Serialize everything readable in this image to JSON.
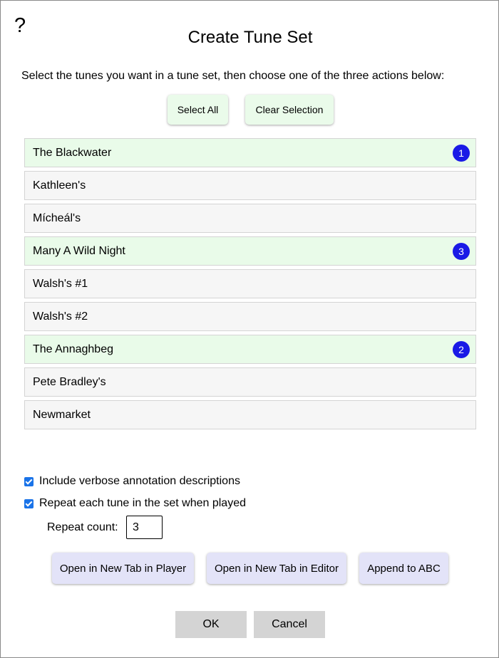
{
  "dialog": {
    "help_icon": "?",
    "title": "Create Tune Set",
    "instructions": "Select the tunes you want in a tune set, then choose one of the three actions below:"
  },
  "selection_buttons": {
    "select_all": "Select All",
    "clear_selection": "Clear Selection"
  },
  "tunes": [
    {
      "name": "The Blackwater",
      "selected": true,
      "order": "1"
    },
    {
      "name": "Kathleen's",
      "selected": false,
      "order": ""
    },
    {
      "name": "Mícheál's",
      "selected": false,
      "order": ""
    },
    {
      "name": "Many A Wild Night",
      "selected": true,
      "order": "3"
    },
    {
      "name": "Walsh's #1",
      "selected": false,
      "order": ""
    },
    {
      "name": "Walsh's #2",
      "selected": false,
      "order": ""
    },
    {
      "name": "The Annaghbeg",
      "selected": true,
      "order": "2"
    },
    {
      "name": "Pete Bradley's",
      "selected": false,
      "order": ""
    },
    {
      "name": "Newmarket",
      "selected": false,
      "order": ""
    }
  ],
  "options": {
    "verbose_label": "Include verbose annotation descriptions",
    "verbose_checked": true,
    "repeat_label": "Repeat each tune in the set when played",
    "repeat_checked": true,
    "repeat_count_label": "Repeat count:",
    "repeat_count_value": "3"
  },
  "actions": {
    "open_player": "Open in New Tab in Player",
    "open_editor": "Open in New Tab in Editor",
    "append_abc": "Append to ABC"
  },
  "footer": {
    "ok": "OK",
    "cancel": "Cancel"
  },
  "colors": {
    "selected_row": "#e9fbe9",
    "unselected_row": "#f6f6f6",
    "badge": "#1a1ae6",
    "checkbox": "#1a73e8",
    "select_button": "#eafbea",
    "action_button": "#e3e3f8",
    "footer_button": "#d4d4d4"
  }
}
